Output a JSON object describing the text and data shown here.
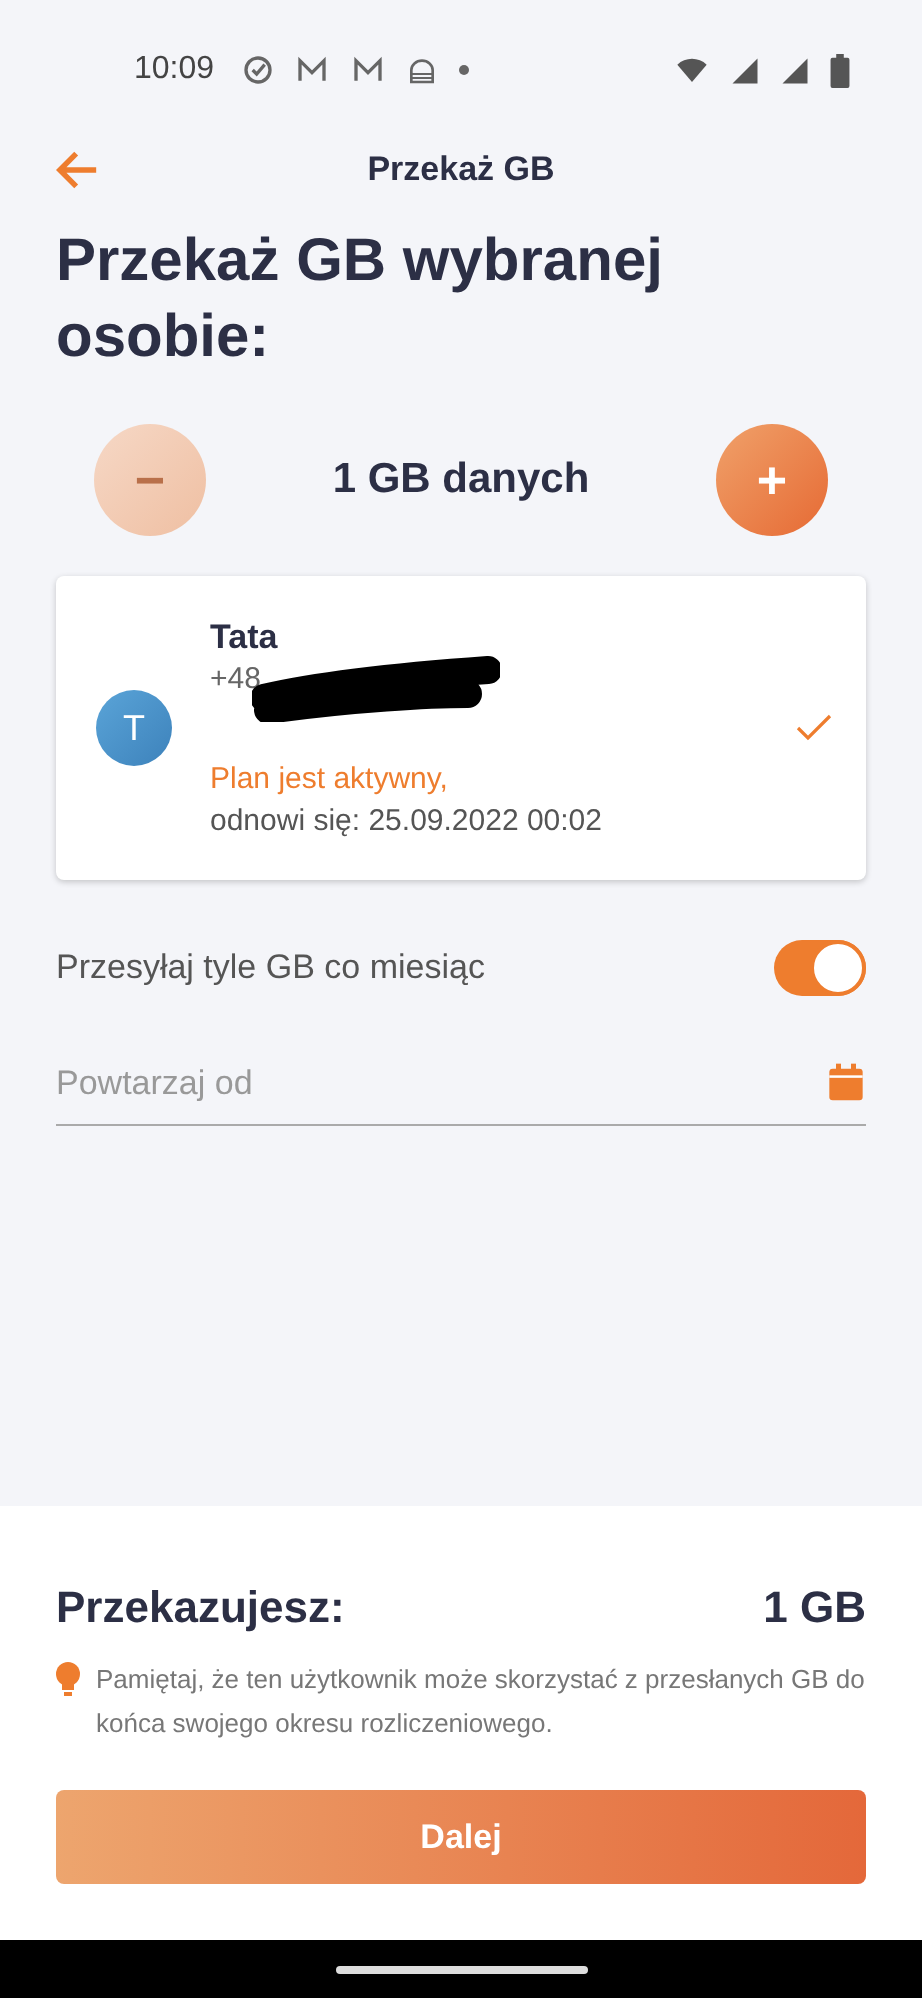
{
  "status_bar": {
    "time": "10:09"
  },
  "header": {
    "title": "Przekaż GB"
  },
  "heading": "Przekaż GB wybranej osobie:",
  "stepper": {
    "minus": {
      "label": "−",
      "disabled": true
    },
    "value": "1 GB danych",
    "plus": {
      "label": "+",
      "disabled": false
    }
  },
  "recipient": {
    "avatar": "T",
    "name": "Tata",
    "phone": "+48",
    "status": "Plan jest aktywny,",
    "renewal": "odnowi się: 25.09.2022 00:02",
    "selected": true
  },
  "monthly": {
    "label": "Przesyłaj tyle GB co miesiąc",
    "on": true
  },
  "repeat_field": {
    "placeholder": "Powtarzaj od"
  },
  "summary": {
    "label": "Przekazujesz:",
    "value": "1 GB",
    "note": "Pamiętaj, że ten użytkownik może skorzystać z przesłanych GB do końca swojego okresu rozliczeniowego."
  },
  "next_button": "Dalej"
}
